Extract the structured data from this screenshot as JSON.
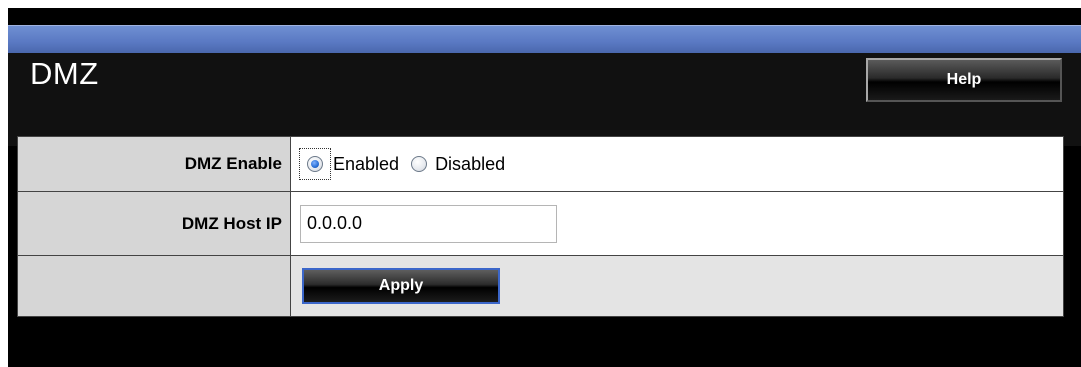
{
  "page": {
    "title": "DMZ"
  },
  "header": {
    "help_label": "Help"
  },
  "form": {
    "dmz_enable": {
      "label": "DMZ Enable",
      "options": [
        "Enabled",
        "Disabled"
      ],
      "selected": "Enabled"
    },
    "dmz_host_ip": {
      "label": "DMZ Host IP",
      "value": "0.0.0.0"
    },
    "apply_label": "Apply"
  },
  "colors": {
    "top_bar": "#5a79c3",
    "background": "#000000",
    "label_cell": "#d6d6d6",
    "apply_border": "#3b66c9"
  },
  "icons": [
    "radio-selected-icon",
    "radio-unselected-icon"
  ]
}
